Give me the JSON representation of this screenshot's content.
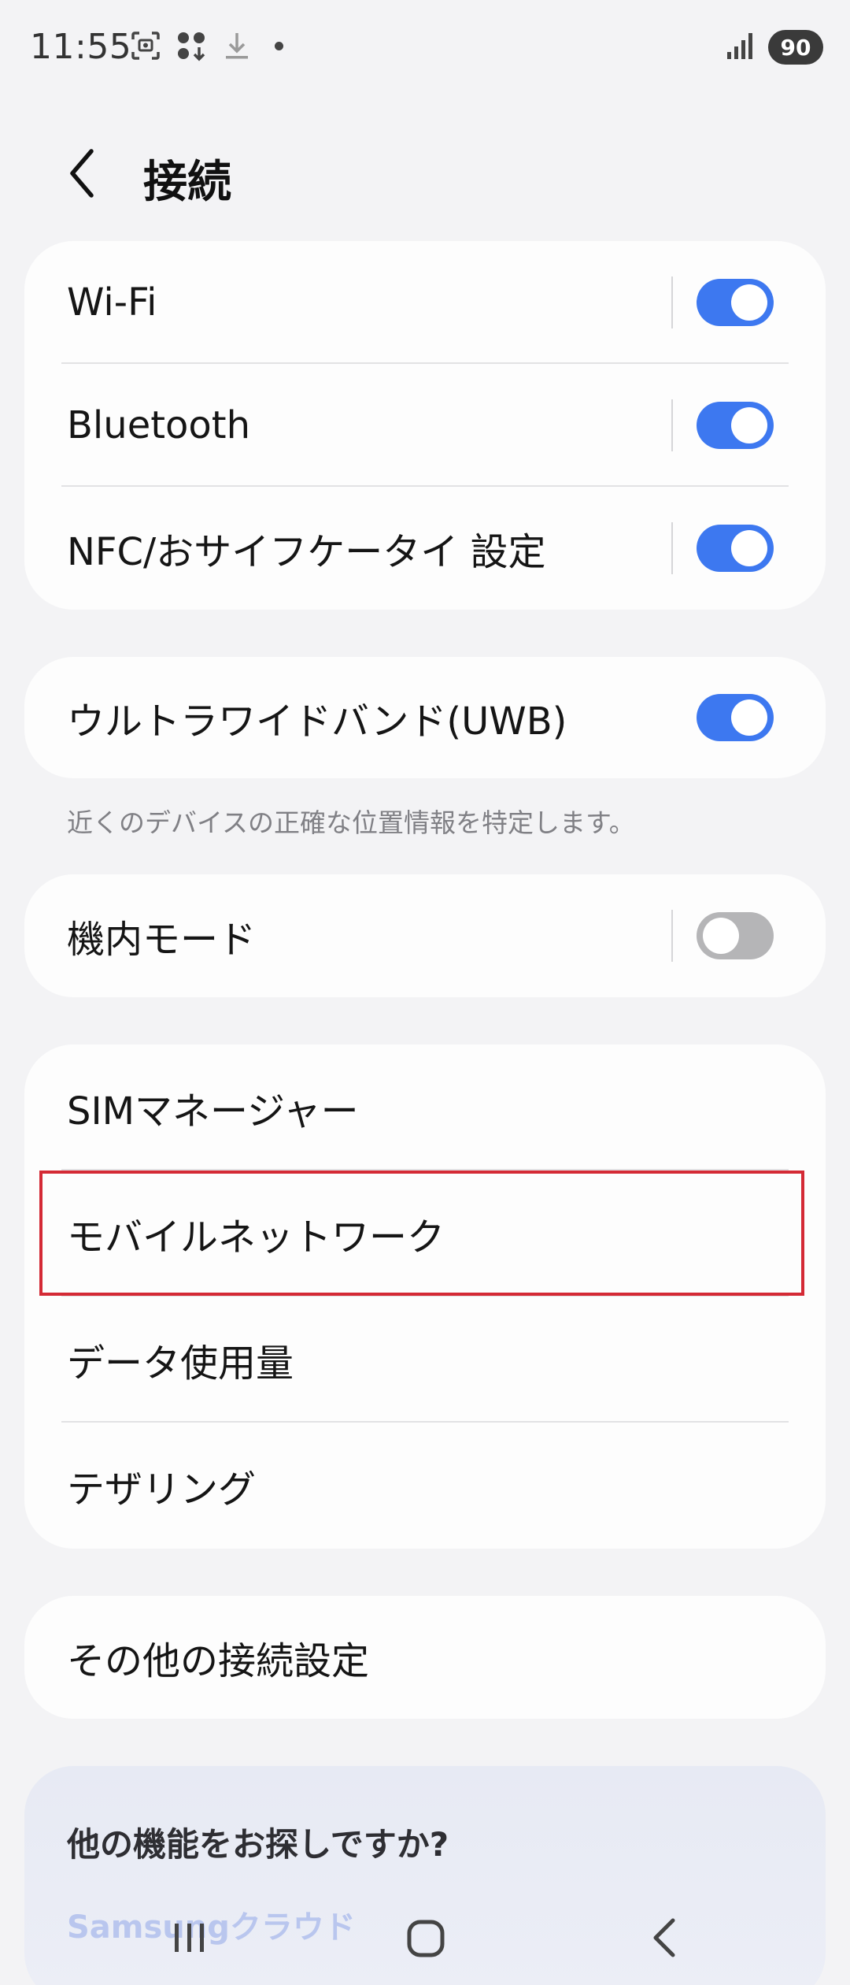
{
  "status_bar": {
    "time": "11:55",
    "battery": "90",
    "icons": [
      "screenshot-icon",
      "apps-icon",
      "download-icon",
      "dot-icon",
      "signal-icon"
    ]
  },
  "header": {
    "title": "接続",
    "back_icon": "chevron-left-icon"
  },
  "group1": {
    "items": [
      {
        "label": "Wi-Fi",
        "toggle": true
      },
      {
        "label": "Bluetooth",
        "toggle": true
      },
      {
        "label": "NFC/おサイフケータイ 設定",
        "toggle": true
      }
    ]
  },
  "uwb": {
    "label": "ウルトラワイドバンド(UWB)",
    "toggle": true,
    "note": "近くのデバイスの正確な位置情報を特定します。"
  },
  "airplane": {
    "label": "機内モード",
    "toggle": false
  },
  "group2": {
    "items": [
      {
        "label": "SIMマネージャー"
      },
      {
        "label": "モバイルネットワーク",
        "highlighted": true
      },
      {
        "label": "データ使用量"
      },
      {
        "label": "テザリング"
      }
    ]
  },
  "other": {
    "label": "その他の接続設定"
  },
  "promo": {
    "title": "他の機能をお探しですか?",
    "link": "Samsungクラウド"
  },
  "nav": {
    "icons": [
      "recents-icon",
      "home-icon",
      "back-icon"
    ]
  },
  "colors": {
    "toggle_on": "#3d78f0",
    "toggle_off": "#b5b5b7",
    "highlight_border": "#d42a35",
    "background": "#f3f3f5"
  }
}
